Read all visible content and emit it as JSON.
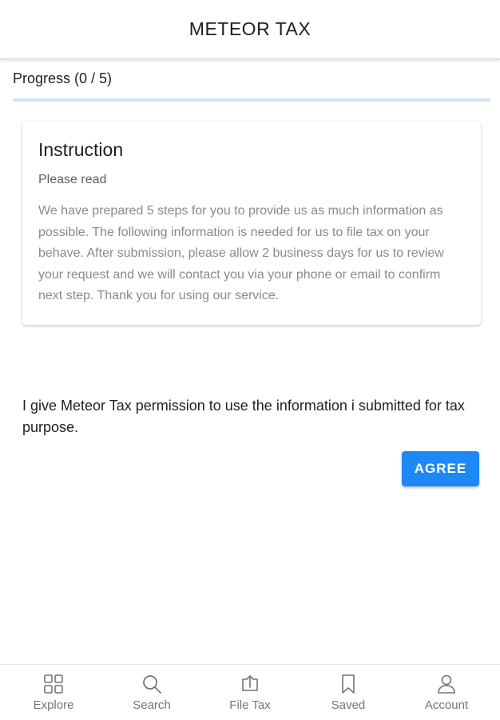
{
  "header": {
    "title": "METEOR TAX"
  },
  "progress": {
    "label": "Progress (0 / 5)",
    "fraction": 0
  },
  "instruction": {
    "title": "Instruction",
    "subtitle": "Please read",
    "body": "We have prepared 5 steps for you to provide us as much information as possible. The following information is needed for us to file tax on your behave. After submission, please allow 2 business days for us to review your request and we will contact you via your phone or email to confirm next step. Thank you for using our service."
  },
  "consent": {
    "text": "I give Meteor Tax permission to use the information i submitted for tax purpose.",
    "agree_label": "AGREE"
  },
  "nav": {
    "items": [
      {
        "label": "Explore",
        "icon": "grid-icon"
      },
      {
        "label": "Search",
        "icon": "search-icon"
      },
      {
        "label": "File Tax",
        "icon": "upload-icon"
      },
      {
        "label": "Saved",
        "icon": "bookmark-icon"
      },
      {
        "label": "Account",
        "icon": "person-icon"
      }
    ]
  },
  "colors": {
    "accent": "#1e88f5",
    "progress_track": "#cfe2fb",
    "nav_gray": "#757575"
  }
}
